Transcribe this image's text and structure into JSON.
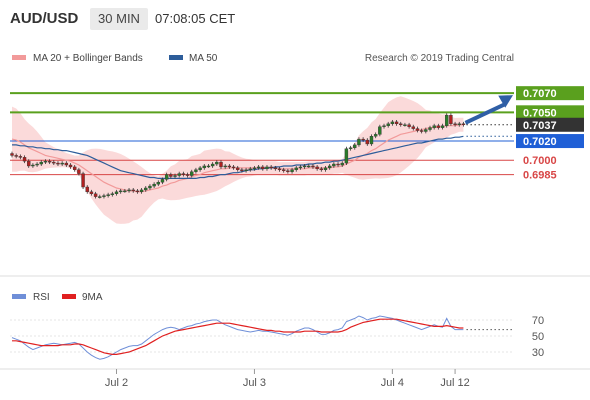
{
  "header": {
    "symbol": "AUD/USD",
    "timeframe": "30 MIN",
    "time": "07:08:05 CET"
  },
  "legend": {
    "ma20_label": "MA 20 + Bollinger Bands",
    "ma50_label": "MA 50",
    "rsi_label": "RSI",
    "ma9_label": "9MA"
  },
  "credit": "Research © 2019 Trading Central",
  "colors": {
    "green_level": "#5aa01e",
    "blue_level": "#1f5fd6",
    "red_level": "#d84646",
    "current_price": "#333333",
    "ma20": "#f29a9a",
    "ma50": "#2d5d9a",
    "band_fill": "#fbd6d6",
    "rsi": "#6f8fd8",
    "ma9": "#e02020",
    "arrow": "#2f5fa6",
    "candle_up": "#2a7a2a",
    "candle_down": "#b02020"
  },
  "chart_data": [
    {
      "type": "candlestick",
      "ylim": [
        0.69,
        0.709
      ],
      "levels": [
        {
          "value": 0.707,
          "label": "0.7070",
          "kind": "resistance",
          "color": "green"
        },
        {
          "value": 0.705,
          "label": "0.7050",
          "kind": "resistance",
          "color": "green"
        },
        {
          "value": 0.7037,
          "label": "0.7037",
          "kind": "current",
          "color": "dark"
        },
        {
          "value": 0.702,
          "label": "0.7020",
          "kind": "pivot",
          "color": "blue"
        },
        {
          "value": 0.7,
          "label": "0.7000",
          "kind": "support",
          "color": "red"
        },
        {
          "value": 0.6985,
          "label": "0.6985",
          "kind": "support",
          "color": "red"
        }
      ],
      "x_ticks": [
        {
          "label": "Jul 2",
          "index": 25
        },
        {
          "label": "Jul 3",
          "index": 58
        },
        {
          "label": "Jul 4",
          "index": 91
        },
        {
          "label": "Jul 12",
          "index": 106
        }
      ],
      "close": [
        0.7005,
        0.7004,
        0.7003,
        0.6999,
        0.6994,
        0.6995,
        0.6996,
        0.6998,
        0.6999,
        0.6998,
        0.6997,
        0.6996,
        0.6997,
        0.6995,
        0.6993,
        0.699,
        0.6986,
        0.6972,
        0.6967,
        0.6965,
        0.6962,
        0.6962,
        0.6963,
        0.6964,
        0.6965,
        0.6967,
        0.6968,
        0.6968,
        0.6969,
        0.6968,
        0.6967,
        0.6969,
        0.6971,
        0.6973,
        0.6975,
        0.6977,
        0.698,
        0.6985,
        0.6983,
        0.6984,
        0.6986,
        0.6985,
        0.6984,
        0.6988,
        0.699,
        0.6992,
        0.6994,
        0.6994,
        0.6996,
        0.6998,
        0.6993,
        0.6994,
        0.6993,
        0.6992,
        0.699,
        0.6989,
        0.699,
        0.6991,
        0.6992,
        0.6993,
        0.6991,
        0.6993,
        0.6992,
        0.6991,
        0.699,
        0.6989,
        0.6988,
        0.699,
        0.6992,
        0.6993,
        0.6994,
        0.6994,
        0.6993,
        0.6991,
        0.699,
        0.6992,
        0.6994,
        0.6996,
        0.6995,
        0.6997,
        0.7012,
        0.7013,
        0.7016,
        0.7022,
        0.7021,
        0.7017,
        0.7025,
        0.7027,
        0.7035,
        0.7036,
        0.7038,
        0.704,
        0.7038,
        0.7037,
        0.7037,
        0.7035,
        0.7033,
        0.7031,
        0.703,
        0.7032,
        0.7034,
        0.7036,
        0.7034,
        0.7036,
        0.7047,
        0.7038,
        0.7037,
        0.7038,
        0.7037
      ],
      "ma20": [
        0.7022,
        0.7021,
        0.7019,
        0.7016,
        0.7013,
        0.7011,
        0.7009,
        0.7007,
        0.7005,
        0.7004,
        0.7003,
        0.7002,
        0.7001,
        0.7,
        0.6999,
        0.6997,
        0.6995,
        0.6992,
        0.6989,
        0.6986,
        0.6983,
        0.698,
        0.6977,
        0.6975,
        0.6973,
        0.6971,
        0.697,
        0.6969,
        0.6968,
        0.6968,
        0.6967,
        0.6967,
        0.6968,
        0.6969,
        0.697,
        0.6971,
        0.6973,
        0.6974,
        0.6976,
        0.6977,
        0.6979,
        0.698,
        0.6981,
        0.6983,
        0.6984,
        0.6985,
        0.6987,
        0.6988,
        0.6989,
        0.699,
        0.6991,
        0.6991,
        0.6992,
        0.6992,
        0.6992,
        0.6992,
        0.6992,
        0.6992,
        0.6992,
        0.6992,
        0.6992,
        0.6992,
        0.6992,
        0.6992,
        0.6991,
        0.6991,
        0.6991,
        0.6991,
        0.6991,
        0.6991,
        0.6991,
        0.6992,
        0.6992,
        0.6992,
        0.6992,
        0.6992,
        0.6992,
        0.6993,
        0.6993,
        0.6994,
        0.6996,
        0.6998,
        0.7,
        0.7003,
        0.7005,
        0.7007,
        0.701,
        0.7012,
        0.7015,
        0.7018,
        0.7021,
        0.7023,
        0.7025,
        0.7027,
        0.7028,
        0.7029,
        0.703,
        0.7031,
        0.7032,
        0.7033,
        0.7034,
        0.7034,
        0.7035,
        0.7035,
        0.7036,
        0.7036,
        0.7036,
        0.7037,
        0.7037
      ],
      "ma50": [
        0.7016,
        0.7016,
        0.7015,
        0.7015,
        0.7014,
        0.7014,
        0.7013,
        0.7013,
        0.7012,
        0.7012,
        0.7011,
        0.7011,
        0.701,
        0.701,
        0.7009,
        0.7008,
        0.7007,
        0.7006,
        0.7005,
        0.7003,
        0.7001,
        0.6999,
        0.6997,
        0.6995,
        0.6993,
        0.6991,
        0.6989,
        0.6988,
        0.6987,
        0.6986,
        0.6985,
        0.6984,
        0.6983,
        0.6982,
        0.6982,
        0.6981,
        0.6981,
        0.6981,
        0.6981,
        0.6981,
        0.6981,
        0.6981,
        0.6981,
        0.6981,
        0.6981,
        0.6982,
        0.6982,
        0.6983,
        0.6983,
        0.6984,
        0.6985,
        0.6985,
        0.6986,
        0.6987,
        0.6987,
        0.6988,
        0.6989,
        0.699,
        0.699,
        0.6991,
        0.6991,
        0.6992,
        0.6992,
        0.6993,
        0.6993,
        0.6994,
        0.6994,
        0.6994,
        0.6995,
        0.6995,
        0.6995,
        0.6996,
        0.6996,
        0.6997,
        0.6997,
        0.6998,
        0.6998,
        0.6999,
        0.6999,
        0.7,
        0.7001,
        0.7002,
        0.7003,
        0.7004,
        0.7005,
        0.7006,
        0.7007,
        0.7008,
        0.7009,
        0.701,
        0.7011,
        0.7012,
        0.7013,
        0.7014,
        0.7015,
        0.7016,
        0.7017,
        0.7018,
        0.7018,
        0.7019,
        0.702,
        0.7021,
        0.7022,
        0.7022,
        0.7023,
        0.7023,
        0.7024,
        0.7024,
        0.7025
      ]
    },
    {
      "type": "line",
      "ylim": [
        15,
        85
      ],
      "y_ticks": [
        30,
        50,
        70
      ],
      "series": [
        {
          "name": "RSI",
          "values": [
            48,
            46,
            44,
            40,
            36,
            33,
            35,
            37,
            39,
            40,
            41,
            40,
            39,
            40,
            41,
            42,
            40,
            35,
            30,
            26,
            23,
            21,
            22,
            24,
            27,
            30,
            33,
            35,
            37,
            38,
            38,
            40,
            44,
            48,
            52,
            55,
            58,
            60,
            61,
            60,
            58,
            60,
            62,
            63,
            65,
            66,
            68,
            69,
            70,
            70,
            67,
            64,
            62,
            60,
            58,
            57,
            56,
            55,
            56,
            57,
            56,
            56,
            55,
            54,
            53,
            52,
            51,
            53,
            56,
            58,
            60,
            60,
            58,
            55,
            52,
            52,
            54,
            57,
            58,
            60,
            68,
            70,
            72,
            75,
            73,
            70,
            72,
            73,
            75,
            74,
            73,
            72,
            70,
            68,
            66,
            64,
            62,
            60,
            58,
            60,
            62,
            64,
            62,
            61,
            72,
            62,
            58,
            58,
            58
          ]
        },
        {
          "name": "9MA",
          "values": [
            44,
            44,
            43,
            42,
            41,
            40,
            39,
            38,
            38,
            38,
            38,
            38,
            39,
            39,
            39,
            40,
            40,
            39,
            37,
            35,
            33,
            31,
            29,
            28,
            27,
            27,
            28,
            29,
            30,
            32,
            34,
            36,
            38,
            41,
            44,
            47,
            50,
            52,
            54,
            56,
            57,
            58,
            59,
            60,
            61,
            62,
            63,
            64,
            65,
            66,
            66,
            66,
            66,
            65,
            64,
            63,
            62,
            61,
            60,
            59,
            58,
            57,
            57,
            56,
            56,
            55,
            55,
            55,
            55,
            55,
            56,
            56,
            56,
            56,
            55,
            55,
            55,
            55,
            55,
            56,
            58,
            61,
            63,
            65,
            67,
            68,
            69,
            70,
            71,
            71,
            71,
            71,
            71,
            70,
            69,
            68,
            67,
            66,
            65,
            64,
            63,
            62,
            62,
            62,
            63,
            62,
            61,
            60,
            60
          ]
        }
      ]
    }
  ]
}
